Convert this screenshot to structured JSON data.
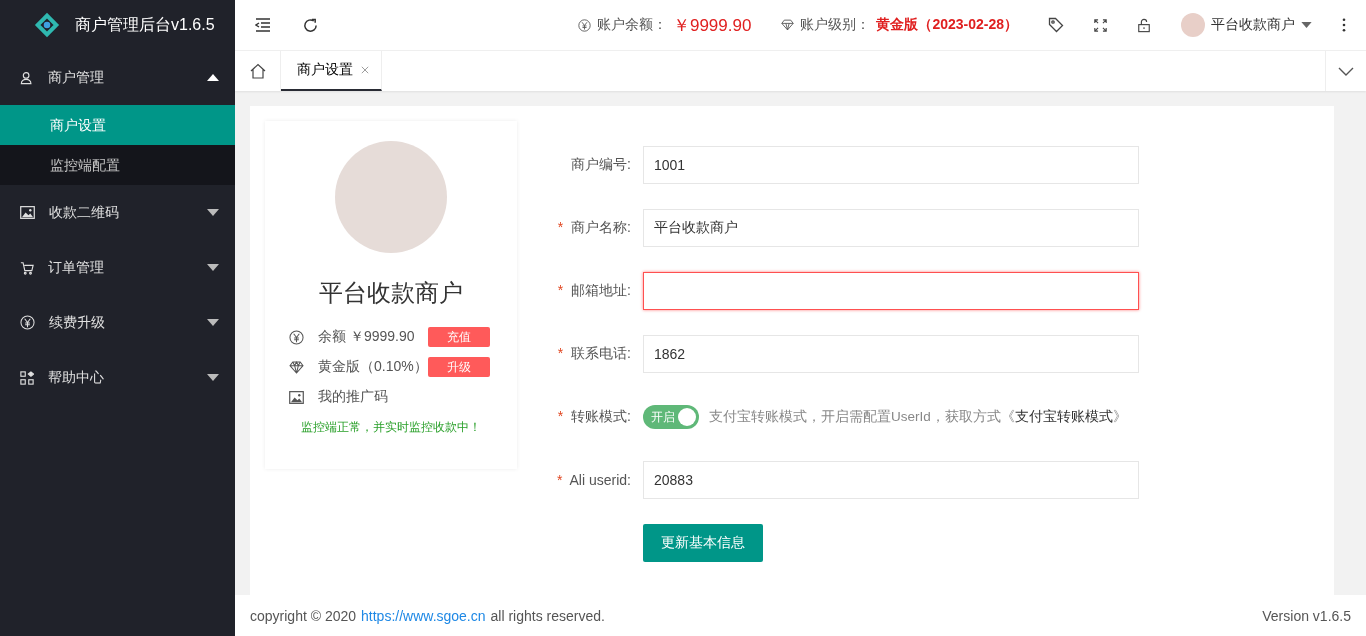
{
  "app": {
    "title": "商户管理后台v1.6.5"
  },
  "sidebar": {
    "items": [
      {
        "label": "商户管理",
        "expanded": true,
        "children": [
          {
            "label": "商户设置",
            "selected": true
          },
          {
            "label": "监控端配置",
            "selected": false
          }
        ]
      },
      {
        "label": "收款二维码",
        "expanded": false
      },
      {
        "label": "订单管理",
        "expanded": false
      },
      {
        "label": "续费升级",
        "expanded": false
      },
      {
        "label": "帮助中心",
        "expanded": false
      }
    ]
  },
  "header": {
    "balance_label": "账户余额：",
    "balance": "￥9999.90",
    "level_label": "账户级别：",
    "level": "黄金版（2023-02-28）",
    "user": "平台收款商户"
  },
  "tabs": [
    {
      "label": "商户设置",
      "selected": true
    }
  ],
  "profile": {
    "name": "平台收款商户",
    "rows": [
      {
        "text": "余额 ￥9999.90",
        "button": "充值"
      },
      {
        "text": "黄金版（0.10%）",
        "button": "升级"
      },
      {
        "text": "我的推广码"
      }
    ],
    "status": "监控端正常，并实时监控收款中！"
  },
  "form": {
    "fields": [
      {
        "kind": "input",
        "label": "商户编号:",
        "value": "1001",
        "error": false
      },
      {
        "kind": "input",
        "label": "商户名称:",
        "required_mark": "*",
        "value": "平台收款商户",
        "error": false
      },
      {
        "kind": "input",
        "label": "邮箱地址:",
        "required_mark": "*",
        "error": true
      },
      {
        "kind": "input",
        "label": "联系电话:",
        "required_mark": "*",
        "value": "1862",
        "error": false
      },
      {
        "kind": "switch",
        "label": "转账模式:",
        "required_mark": "*",
        "on": true,
        "switch_text": "开启",
        "hint": "支付宝转账模式，开启需配置UserId，获取方式《**支付宝转账模式**》"
      },
      {
        "kind": "input",
        "label": "Ali userid:",
        "required_mark": "*",
        "value": "20883",
        "error": false
      }
    ],
    "submit": "更新基本信息"
  },
  "footer": {
    "copyright": "copyright © 2020",
    "link": "https://www.sgoe.cn",
    "rights": "all rights reserved.",
    "version": "Version v1.6.5"
  }
}
